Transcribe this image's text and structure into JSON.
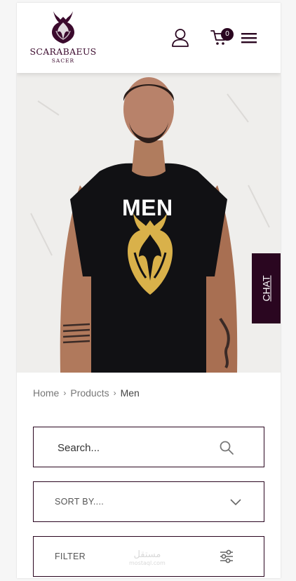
{
  "brand": {
    "name": "SCARABAEUS",
    "sub": "SACER"
  },
  "header": {
    "cart_count": "0"
  },
  "hero": {
    "title": "MEN"
  },
  "chat": {
    "label": "CHAT"
  },
  "breadcrumb": {
    "items": [
      "Home",
      "Products",
      "Men"
    ]
  },
  "search": {
    "placeholder": "Search..."
  },
  "sort": {
    "label": "SORT BY...."
  },
  "filter": {
    "label": "FILTER"
  },
  "watermark": {
    "main": "مستقل",
    "sub": "mostaql.com"
  },
  "colors": {
    "brand": "#3b0a2d",
    "dark": "#2a0620",
    "gold": "#d9b14a"
  },
  "icons": [
    "beetle-logo",
    "user-icon",
    "cart-icon",
    "menu-icon",
    "search-icon",
    "chevron-down-icon",
    "sliders-icon"
  ]
}
